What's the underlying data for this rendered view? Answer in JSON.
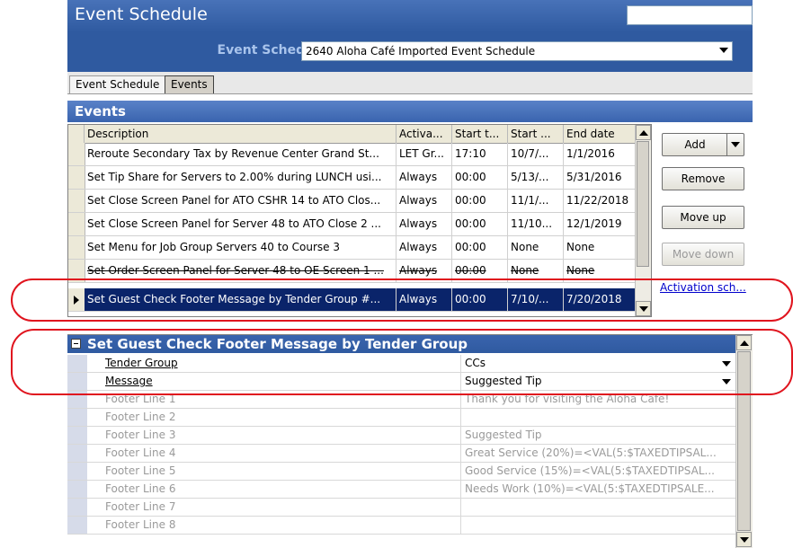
{
  "window": {
    "title": "Event Schedule"
  },
  "schedule": {
    "label": "Event Schedule:",
    "value": "2640 Aloha Café Imported Event Schedule"
  },
  "tabs": [
    {
      "label": "Event Schedule"
    },
    {
      "label": "Events"
    }
  ],
  "events_section": {
    "title": "Events"
  },
  "grid": {
    "columns": [
      "Description",
      "Activa...",
      "Start t...",
      "Start ...",
      "End date"
    ],
    "rows": [
      [
        "Reroute Secondary Tax by Revenue Center Grand St...",
        "LET Gr...",
        "17:10",
        "10/7/...",
        "1/1/2016"
      ],
      [
        "Set Tip Share for Servers to 2.00% during LUNCH usi...",
        "Always",
        "00:00",
        "5/13/...",
        "5/31/2016"
      ],
      [
        "Set Close Screen Panel for ATO CSHR 14 to ATO Clos...",
        "Always",
        "00:00",
        "11/1/...",
        "11/22/2018"
      ],
      [
        "Set Close Screen Panel for Server 48 to ATO Close 2 ...",
        "Always",
        "00:00",
        "11/10...",
        "12/1/2019"
      ],
      [
        "Set Menu for Job Group Servers 40 to Course 3",
        "Always",
        "00:00",
        "None",
        "None"
      ],
      [
        "Set Order Screen Panel for Server 48 to OE Screen 1 ...",
        "Always",
        "00:00",
        "None",
        "None"
      ],
      [
        "Set Guest Check Footer Message by Tender Group #...",
        "Always",
        "00:00",
        "7/10/...",
        "7/20/2018"
      ]
    ],
    "selected_row": 6
  },
  "buttons": {
    "add": "Add",
    "remove": "Remove",
    "move_up": "Move up",
    "move_down": "Move down"
  },
  "link": {
    "activation": "Activation sch..."
  },
  "properties": {
    "title": "Set Guest Check Footer Message by Tender Group",
    "rows": [
      {
        "name": "Tender Group",
        "value": "CCs"
      },
      {
        "name": "Message",
        "value": "Suggested Tip"
      },
      {
        "name": "Footer Line 1",
        "value": "Thank you for visiting the Aloha Café!"
      },
      {
        "name": "Footer Line 2",
        "value": ""
      },
      {
        "name": "Footer Line 3",
        "value": "Suggested Tip"
      },
      {
        "name": "Footer Line 4",
        "value": "Great Service (20%)=<VAL(5:$TAXEDTIPSAL..."
      },
      {
        "name": "Footer Line 5",
        "value": "Good Service (15%)=<VAL(5:$TAXEDTIPSAL..."
      },
      {
        "name": "Footer Line 6",
        "value": "Needs Work (10%)=<VAL(5:$TAXEDTIPSALE..."
      },
      {
        "name": "Footer Line 7",
        "value": ""
      },
      {
        "name": "Footer Line 8",
        "value": ""
      }
    ]
  },
  "colors": {
    "title_bar": "#2f5aa0",
    "selection": "#0a246a",
    "highlight_oval": "#e0141e",
    "link": "#0000cc"
  }
}
